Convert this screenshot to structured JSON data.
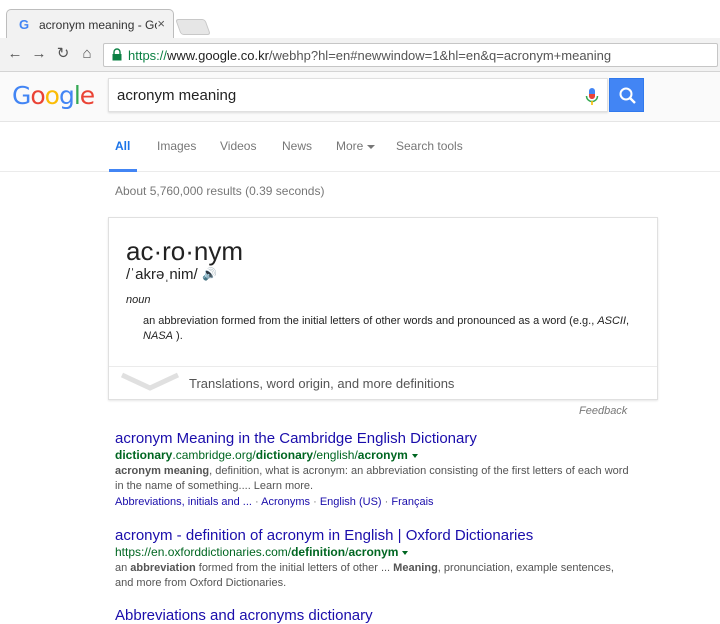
{
  "browser": {
    "tab_title": "acronym meaning - Goo",
    "tab_close": "×",
    "favicon": "G",
    "url_https": "https://",
    "url_host": "www.google.co.kr",
    "url_rest": "/webhp?hl=en#newwindow=1&hl=en&q=acronym+meaning",
    "back_icon": "←",
    "forward_icon": "→",
    "reload_icon": "↻",
    "home_icon": "⌂"
  },
  "google": {
    "logo_letters": [
      "G",
      "o",
      "o",
      "g",
      "l",
      "e"
    ],
    "logo_colors": [
      "#4285f4",
      "#ea4335",
      "#fbbc05",
      "#4285f4",
      "#34a853",
      "#ea4335"
    ],
    "query": "acronym meaning"
  },
  "nav": {
    "items": [
      "All",
      "Images",
      "Videos",
      "News",
      "More",
      "Search tools"
    ]
  },
  "stats": "About 5,760,000 results (0.39 seconds)",
  "dictionary": {
    "word": "ac·ro·nym",
    "phonetic": "/ˈakrəˌnim/",
    "speaker": "🔊",
    "pos": "noun",
    "definition_pre": "an abbreviation formed from the initial letters of other words and pronounced as a word (e.g., ",
    "definition_ex1": "ASCII",
    "definition_mid": ", ",
    "definition_ex2": "NASA",
    "definition_post": " ).",
    "more_link": "Translations, word origin, and more definitions",
    "feedback": "Feedback"
  },
  "results": [
    {
      "title": "acronym Meaning in the Cambridge English Dictionary",
      "url_pre": "dictionary",
      "url_mid": ".cambridge.org/",
      "url_b1": "dictionary",
      "url_mid2": "/english/",
      "url_b2": "acronym",
      "snippet_b": "acronym meaning",
      "snippet": ", definition, what is acronym: an abbreviation consisting of the first letters of each word in the name of something.... Learn more.",
      "links": [
        "Abbreviations, initials and ...",
        "Acronyms",
        "English (US)",
        "Français"
      ]
    },
    {
      "title": "acronym - definition of acronym in English | Oxford Dictionaries",
      "url_pre": "https://en.oxforddictionaries.com/",
      "url_b1": "definition",
      "url_mid2": "/",
      "url_b2": "acronym",
      "snippet_a": "an ",
      "snippet_b": "abbreviation",
      "snippet_c": " formed from the initial letters of other ... ",
      "snippet_d": "Meaning",
      "snippet_e": ", pronunciation, example sentences, and more from Oxford Dictionaries."
    },
    {
      "title": "Abbreviations and acronyms dictionary"
    }
  ]
}
